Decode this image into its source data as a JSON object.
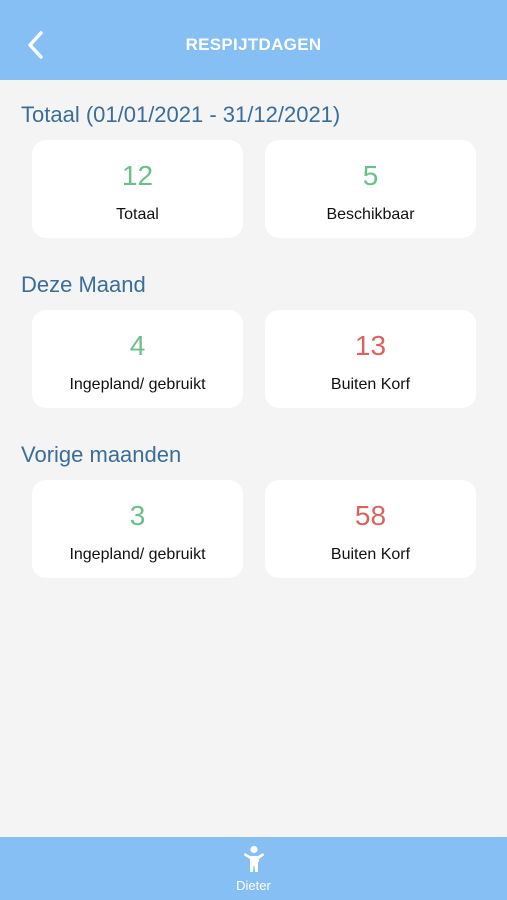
{
  "header": {
    "title": "RESPIJTDAGEN",
    "back_icon": "chevron-left-icon"
  },
  "colors": {
    "header_bg": "#86bff3",
    "section_title": "#3a6d99",
    "value_green": "#6cbf8a",
    "value_red": "#d9645f",
    "background": "#f4f4f4"
  },
  "sections": [
    {
      "title": "Totaal (01/01/2021 - 31/12/2021)",
      "cards": [
        {
          "value": "12",
          "label": "Totaal",
          "status": "green"
        },
        {
          "value": "5",
          "label": "Beschikbaar",
          "status": "green"
        }
      ]
    },
    {
      "title": "Deze Maand",
      "cards": [
        {
          "value": "4",
          "label": "Ingepland/ gebruikt",
          "status": "green"
        },
        {
          "value": "13",
          "label": "Buiten Korf",
          "status": "red"
        }
      ]
    },
    {
      "title": "Vorige maanden",
      "cards": [
        {
          "value": "3",
          "label": "Ingepland/ gebruikt",
          "status": "green"
        },
        {
          "value": "58",
          "label": "Buiten Korf",
          "status": "red"
        }
      ]
    }
  ],
  "tabbar": {
    "items": [
      {
        "label": "Dieter",
        "icon": "child-icon"
      }
    ]
  }
}
